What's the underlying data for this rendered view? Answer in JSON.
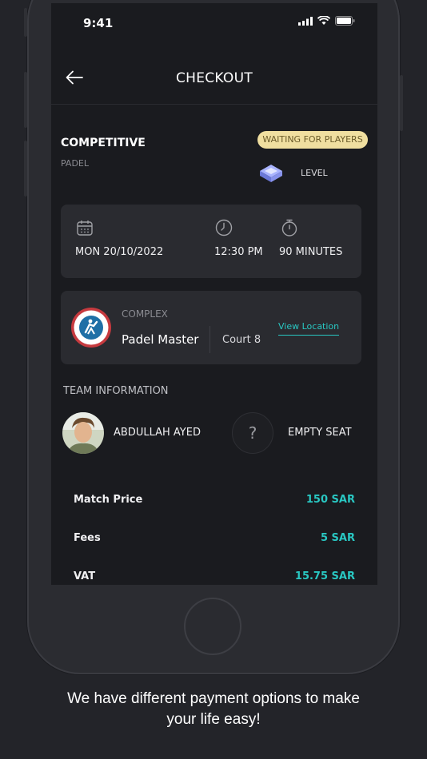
{
  "status": {
    "time": "9:41"
  },
  "nav": {
    "title": "CHECKOUT",
    "back_icon": "arrow-left-icon"
  },
  "match": {
    "mode": "COMPETITIVE",
    "sport": "PADEL",
    "status_badge": "WAITING FOR PLAYERS",
    "level_label": "LEVEL"
  },
  "schedule": {
    "date": "MON 20/10/2022",
    "time": "12:30 PM",
    "duration": "90 MINUTES"
  },
  "complex": {
    "label": "COMPLEX",
    "name": "Padel Master",
    "court": "Court 8",
    "link": "View Location"
  },
  "team": {
    "heading": "TEAM INFORMATION",
    "player_name": "ABDULLAH AYED",
    "empty_symbol": "?",
    "empty_label": "EMPTY SEAT"
  },
  "pricing": [
    {
      "label": "Match Price",
      "value": "150 SAR"
    },
    {
      "label": "Fees",
      "value": "5 SAR"
    },
    {
      "label": "VAT",
      "value": "15.75 SAR"
    }
  ],
  "caption": {
    "line1": "We have different payment options to make",
    "line2": "your life easy!"
  },
  "colors": {
    "accent": "#29c7c2",
    "badge": "#f0dfa0",
    "background": "#1a1b1f",
    "card": "#2a2b30"
  }
}
